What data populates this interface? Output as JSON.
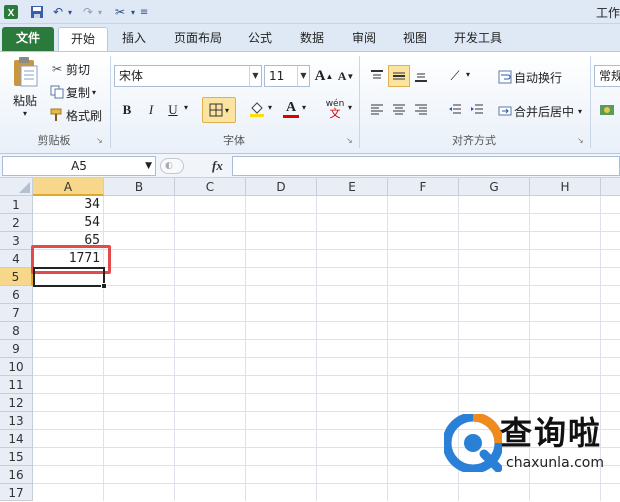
{
  "quick_access": {
    "title_partial": "工作"
  },
  "tabs": [
    "文件",
    "开始",
    "插入",
    "页面布局",
    "公式",
    "数据",
    "审阅",
    "视图",
    "开发工具"
  ],
  "clipboard": {
    "paste": "粘贴",
    "cut": "剪切",
    "copy": "复制",
    "format_painter": "格式刷",
    "group_label": "剪贴板"
  },
  "font": {
    "name": "宋体",
    "size": "11",
    "group_label": "字体",
    "bold": "B",
    "italic": "I",
    "underline": "U",
    "grow": "A",
    "shrink": "A",
    "font_color_letter": "A",
    "wen": "wén"
  },
  "alignment": {
    "wrap_text": "自动换行",
    "merge_center": "合并后居中",
    "group_label": "对齐方式"
  },
  "number": {
    "format_partial": "常规"
  },
  "formula_bar": {
    "name_box": "A5",
    "fx": "fx",
    "content": ""
  },
  "columns": [
    "A",
    "B",
    "C",
    "D",
    "E",
    "F",
    "G",
    "H"
  ],
  "rows": [
    "1",
    "2",
    "3",
    "4",
    "5",
    "6",
    "7",
    "8",
    "9",
    "10",
    "11",
    "12",
    "13",
    "14",
    "15",
    "16",
    "17"
  ],
  "cells": {
    "A1": "34",
    "A2": "54",
    "A3": "65",
    "A4": "1771"
  },
  "selected_cell": "A5",
  "watermark": {
    "brand": "查询啦",
    "url": "chaxunla.com"
  },
  "colors": {
    "file_tab": "#2b7a3c",
    "highlight": "#e14b4b",
    "selected_header": "#f7d88a",
    "watermark_blue": "#2a7fd6",
    "watermark_orange": "#f08a1c"
  }
}
